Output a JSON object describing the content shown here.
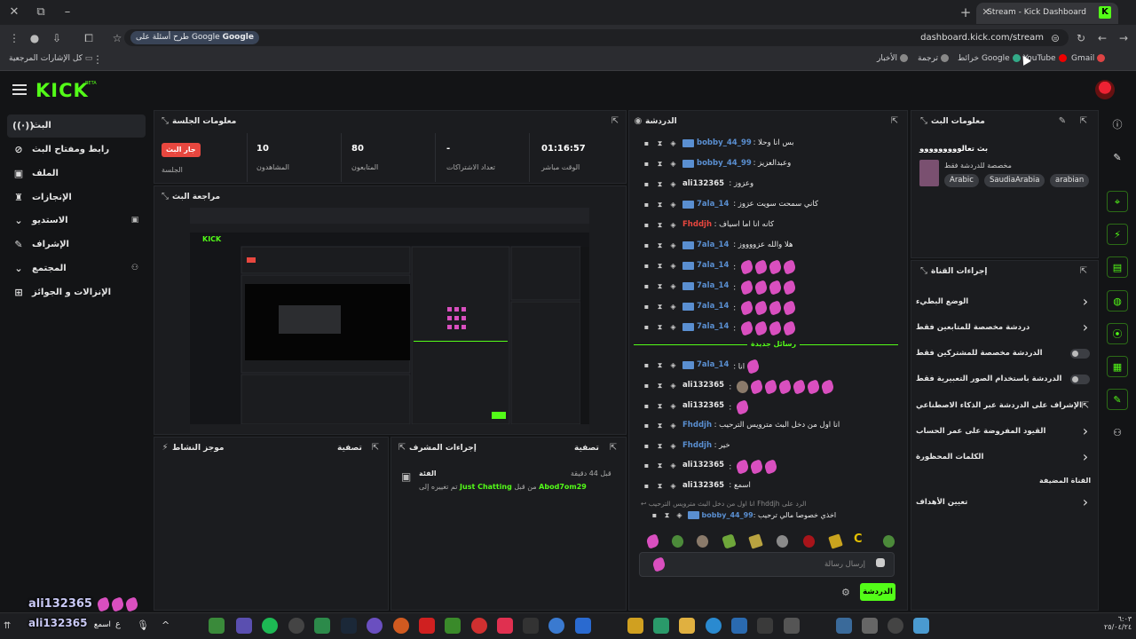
{
  "browser": {
    "tab_title": "Stream - Kick Dashboard",
    "url": "dashboard.kick.com/stream",
    "google_pill": "طرح أسئلة على Google",
    "bookmarks": {
      "all": "كل الإشارات المرجعية",
      "gmail": "Gmail",
      "youtube": "YouTube",
      "maps": "خرائط Google",
      "translate": "ترجمة",
      "news": "الأخبار"
    }
  },
  "app": {
    "logo": "KICK",
    "logo_badge": "BETA"
  },
  "nav": {
    "items": [
      {
        "label": "البث",
        "icon": "broadcast-icon"
      },
      {
        "label": "رابط ومفتاح البث",
        "icon": "link-icon"
      },
      {
        "label": "الملف",
        "icon": "profile-icon"
      },
      {
        "label": "الإنجازات",
        "icon": "trophy-icon"
      },
      {
        "label": "الاستديو",
        "icon": "studio-icon"
      },
      {
        "label": "الإشراف",
        "icon": "wrench-icon"
      },
      {
        "label": "المجتمع",
        "icon": "community-icon"
      },
      {
        "label": "الإنزالات و الجوائز",
        "icon": "gift-icon"
      }
    ]
  },
  "session": {
    "title": "معلومات الجلسة",
    "live_badge": "جار البث",
    "session_label": "الجلسة",
    "stats": [
      {
        "value": "01:16:57",
        "label": "الوقت مباشر"
      },
      {
        "value": "-",
        "label": "تعداد الاشتراكات"
      },
      {
        "value": "80",
        "label": "المتابعون"
      },
      {
        "value": "10",
        "label": "المشاهدون"
      }
    ]
  },
  "preview": {
    "title": "مراجعة البث"
  },
  "activity": {
    "title": "موجز النشاط",
    "filter": "تصفية"
  },
  "mod_actions": {
    "title": "إجراءات المشرف",
    "filter": "تصفية",
    "time": "قبل 44 دقيقة",
    "category_label": "الفئة",
    "action_user": "Abod7om29",
    "action_text": "من قبل",
    "category": "Just Chatting",
    "action_suffix": "تم تغييره إلى"
  },
  "chat": {
    "title": "الدردشة",
    "new_messages": "رسائل جديدة",
    "messages": [
      {
        "user": "bobby_44_99",
        "color": "#5a8fd1",
        "text": "بس انا وحلا",
        "emotes": 0,
        "box": true
      },
      {
        "user": "bobby_44_99",
        "color": "#5a8fd1",
        "text": "وعبدالعزيز",
        "emotes": 0,
        "box": true
      },
      {
        "user": "ali132365",
        "color": "#e6e6e6",
        "text": "وعزوز",
        "emotes": 0,
        "box": false
      },
      {
        "user": "7ala_14",
        "color": "#5a8fd1",
        "text": "كاني سمحت سويت عزوز",
        "emotes": 0,
        "box": true
      },
      {
        "user": "Fhddjh",
        "color": "#e8473f",
        "text": "كانه انا اما اسياف",
        "emotes": 0,
        "box": false
      },
      {
        "user": "7ala_14",
        "color": "#5a8fd1",
        "text": "هلا والله عزووووز",
        "emotes": 0,
        "box": true
      },
      {
        "user": "7ala_14",
        "color": "#5a8fd1",
        "text": "",
        "emotes": 4,
        "box": true
      },
      {
        "user": "7ala_14",
        "color": "#5a8fd1",
        "text": "",
        "emotes": 4,
        "box": true
      },
      {
        "user": "7ala_14",
        "color": "#5a8fd1",
        "text": "",
        "emotes": 4,
        "box": true
      },
      {
        "user": "7ala_14",
        "color": "#5a8fd1",
        "text": "",
        "emotes": 4,
        "box": true
      },
      {
        "user": "7ala_14",
        "color": "#5a8fd1",
        "text": "انا",
        "emotes": 1,
        "box": true
      },
      {
        "user": "ali132365",
        "color": "#e6e6e6",
        "text": "",
        "emotes": 7,
        "box": false
      },
      {
        "user": "ali132365",
        "color": "#e6e6e6",
        "text": "",
        "emotes": 1,
        "box": false
      },
      {
        "user": "Fhddjh",
        "color": "#5a8fd1",
        "text": "انا اول من دخل البث مترويس الترحيب",
        "emotes": 0,
        "box": false
      },
      {
        "user": "Fhddjh",
        "color": "#5a8fd1",
        "text": "خير",
        "emotes": 0,
        "box": false
      },
      {
        "user": "ali132365",
        "color": "#e6e6e6",
        "text": "",
        "emotes": 3,
        "box": false
      },
      {
        "user": "ali132365",
        "color": "#e6e6e6",
        "text": "اسمع",
        "emotes": 0,
        "box": false
      }
    ],
    "reply_prefix": "الرد على",
    "reply_user": "Fhddjh",
    "reply_text": "انا اول من دخل البث مترويس الترحيب",
    "reply_msg_user": "bobby_44_99",
    "reply_msg_text": "اخذي خصوصا مالي ترحيب",
    "input_placeholder": "إرسال رسالة",
    "send_label": "الدردشة"
  },
  "stream_info": {
    "title": "معلومات البث",
    "stream_title": "بث تعالووووووووو",
    "chat_note": "مخصصة للدردشة فقط",
    "tags": [
      "arabian",
      "SaudiaArabia",
      "Arabic"
    ]
  },
  "channel_actions": {
    "title": "إجراءات القناة",
    "items": [
      {
        "label": "الوضع البطيء",
        "control": "chevron"
      },
      {
        "label": "دردشة مخصصة للمتابعين فقط",
        "control": "chevron"
      },
      {
        "label": "الدردشة مخصصة للمشتركين فقط",
        "control": "toggle"
      },
      {
        "label": "الدردشة باستخدام الصور التعبيرية فقط",
        "control": "toggle"
      },
      {
        "label": "الإشراف على الدردشة عبر الذكاء الاصطناعي",
        "control": "external"
      },
      {
        "label": "القيود المفروضة على عمر الحساب",
        "control": "chevron"
      },
      {
        "label": "الكلمات المحظورة",
        "control": "chevron"
      },
      {
        "label": "القناة المضيفة",
        "control": "none"
      },
      {
        "label": "تعيين الأهداف",
        "control": "chevron"
      }
    ]
  },
  "overlay": {
    "user": "ali132365",
    "message": "اسمع"
  },
  "taskbar": {
    "time": "٦:٠٣",
    "date": "٢٥/٠٤/٢٤"
  },
  "colors": {
    "accent": "#53fc18",
    "live": "#e8473f",
    "username_blue": "#5a8fd1",
    "emote_pink": "#d94fbf"
  }
}
